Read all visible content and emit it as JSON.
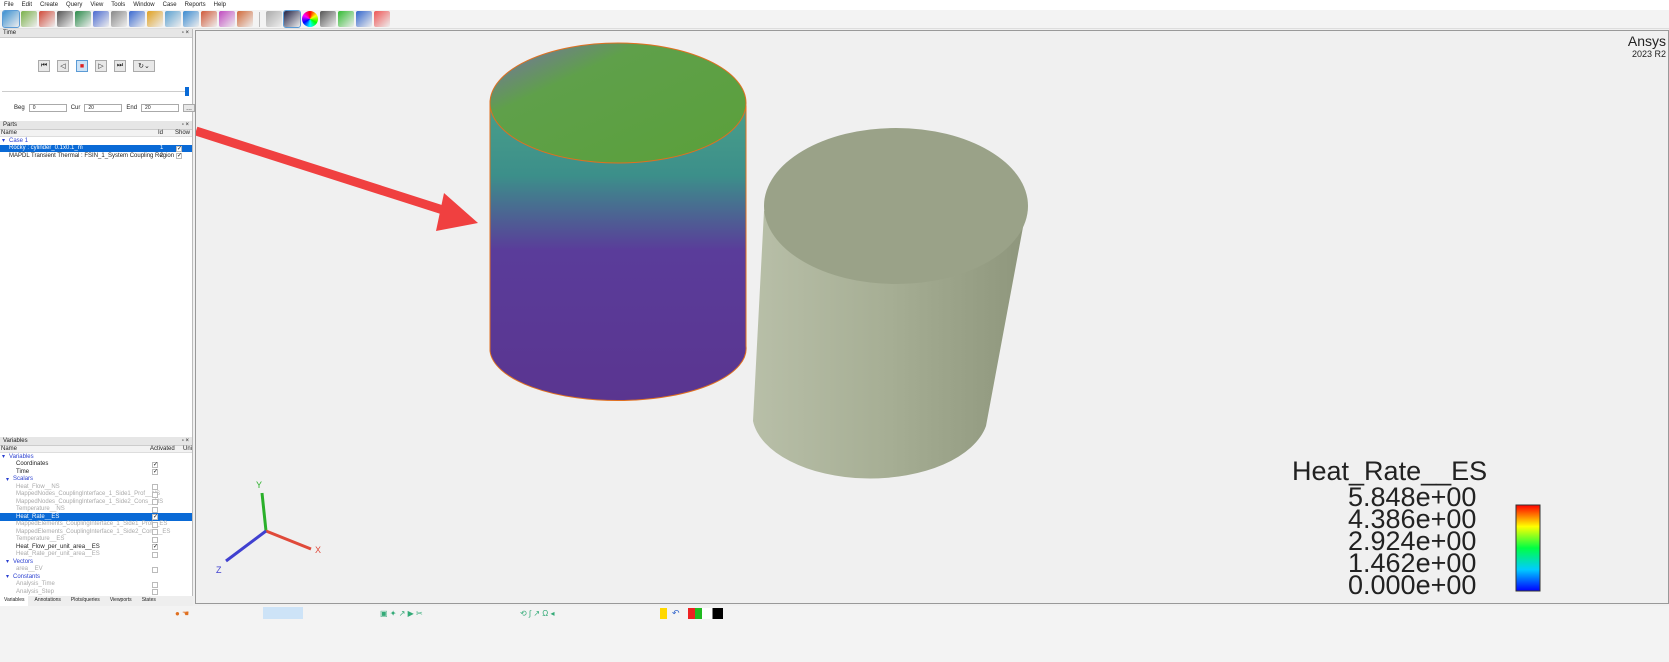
{
  "menu": [
    "File",
    "Edit",
    "Create",
    "Query",
    "View",
    "Tools",
    "Window",
    "Case",
    "Reports",
    "Help"
  ],
  "time_panel": {
    "title": "Time",
    "beg_label": "Beg",
    "beg": "0",
    "cur_label": "Cur",
    "cur": "20",
    "end_label": "End",
    "end": "20",
    "more": "..."
  },
  "parts_panel": {
    "title": "Parts",
    "columns": [
      "Name",
      "Id",
      "Show"
    ],
    "case": "Case 1",
    "items": [
      {
        "name": "Rocky : cylinder_0.1x0.1_m",
        "id": "1",
        "show": true,
        "selected": true
      },
      {
        "name": "MAPDL Transient Thermal : FSIN_1_System Coupling Region",
        "id": "2",
        "show": true,
        "selected": false
      }
    ]
  },
  "variables_panel": {
    "title": "Variables",
    "columns": [
      "Name",
      "Activated",
      "Uni"
    ],
    "rows": [
      {
        "label": "Variables",
        "type": "group",
        "level": 0
      },
      {
        "label": "Coordinates",
        "level": 2,
        "active": true,
        "style": "normal"
      },
      {
        "label": "Time",
        "level": 2,
        "active": true,
        "style": "normal"
      },
      {
        "label": "Scalars",
        "type": "group",
        "level": 1
      },
      {
        "label": "Heat_Flow__NS",
        "level": 2,
        "active": false,
        "style": "gray"
      },
      {
        "label": "MappedNodes_CouplingInterface_1_Side1_Prof__NS",
        "level": 2,
        "active": false,
        "style": "gray"
      },
      {
        "label": "MappedNodes_CouplingInterface_1_Side2_Cons__NS",
        "level": 2,
        "active": false,
        "style": "gray"
      },
      {
        "label": "Temperature__NS",
        "level": 2,
        "active": false,
        "style": "gray"
      },
      {
        "label": "Heat_Rate__ES",
        "level": 2,
        "active": true,
        "style": "selected"
      },
      {
        "label": "MappedElements_CouplingInterface_1_Side1_Prof__ES",
        "level": 2,
        "active": false,
        "style": "gray"
      },
      {
        "label": "MappedElements_CouplingInterface_1_Side2_Cons__ES",
        "level": 2,
        "active": false,
        "style": "gray"
      },
      {
        "label": "Temperature__ES",
        "level": 2,
        "active": false,
        "style": "gray"
      },
      {
        "label": "Heat_Flow_per_unit_area__ES",
        "level": 2,
        "active": true,
        "style": "normal"
      },
      {
        "label": "Heat_Rate_per_unit_area__ES",
        "level": 2,
        "active": false,
        "style": "gray"
      },
      {
        "label": "Vectors",
        "type": "group",
        "level": 1
      },
      {
        "label": "area__EV",
        "level": 2,
        "active": false,
        "style": "gray"
      },
      {
        "label": "Constants",
        "type": "group",
        "level": 1
      },
      {
        "label": "Analysis_Time",
        "level": 2,
        "active": false,
        "style": "gray"
      },
      {
        "label": "Analysis_Step",
        "level": 2,
        "active": false,
        "style": "gray"
      }
    ]
  },
  "tabs": [
    "Variables",
    "Annotations",
    "Plots/queries",
    "Viewports",
    "States"
  ],
  "viewport": {
    "brand": "Ansys",
    "version": "2023 R2",
    "axes": {
      "x": "X",
      "y": "Y",
      "z": "Z"
    },
    "legend": {
      "title": "Heat_Rate__ES",
      "ticks": [
        "5.848e+00",
        "4.386e+00",
        "2.924e+00",
        "1.462e+00",
        "0.000e+00"
      ]
    },
    "colors": {
      "background": "#f0f0f0",
      "arrow": "#f04040",
      "right_cylinder": "#9aa288"
    }
  }
}
